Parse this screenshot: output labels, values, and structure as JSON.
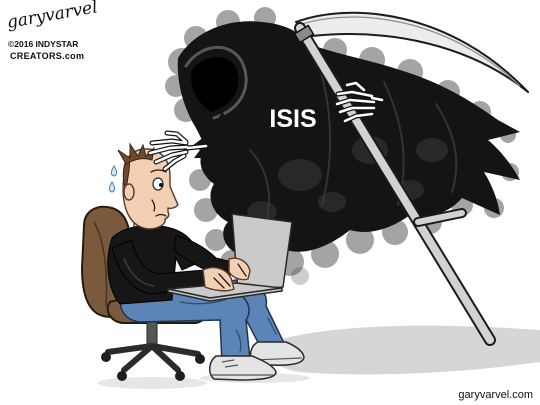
{
  "credits": {
    "signature": "garyvarvel",
    "copyright": "©2016 INDYSTAR",
    "syndicate": "CREATORS.com"
  },
  "reaper": {
    "robe_label": "ISIS"
  },
  "footer": {
    "website": "garyvarvel.com"
  },
  "colors": {
    "cloak": "#141414",
    "smoke": "#4a4a4a",
    "blade": "#ececec",
    "handle": "#d2d2d2",
    "bone": "#ffffff",
    "skin": "#f3cfb3",
    "hair": "#6b4a2f",
    "shirt": "#161616",
    "jeans": "#5c84b6",
    "chair": "#7a5a3c",
    "shoe": "#e4e4e4",
    "laptop": "#cacaca",
    "shadow": "#d6d6d6"
  }
}
